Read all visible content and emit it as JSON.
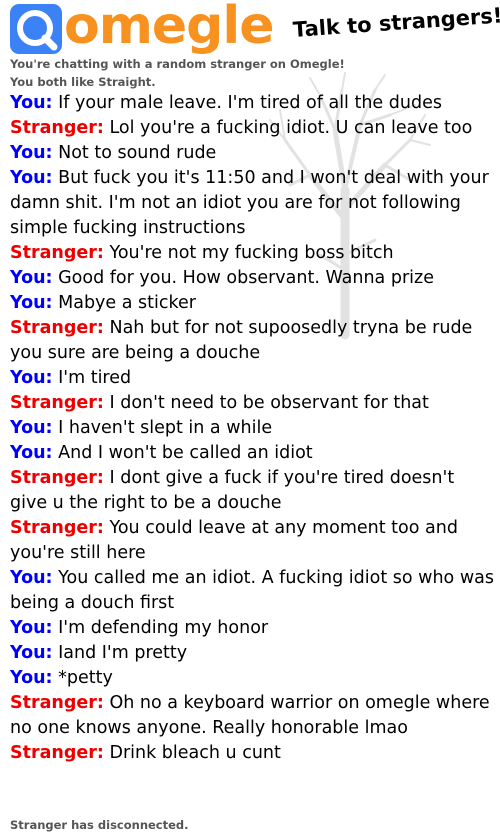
{
  "header": {
    "logo_text": "omegle",
    "tagline": "Talk to strangers!"
  },
  "status": {
    "intro": "You're chatting with a random stranger on Omegle!",
    "likes": "You both like Straight.",
    "end": "Stranger has disconnected."
  },
  "speakers": {
    "you": "You:",
    "stranger": "Stranger:"
  },
  "colors": {
    "you": "#0000ff",
    "stranger": "#ee0000",
    "brand_orange": "#f7911f",
    "brand_blue": "#3b82f6"
  },
  "messages": [
    {
      "speaker": "you",
      "text": "If your male leave. I'm tired of all the dudes"
    },
    {
      "speaker": "stranger",
      "text": "Lol you're a fucking idiot. U can leave too"
    },
    {
      "speaker": "you",
      "text": "Not to sound rude"
    },
    {
      "speaker": "you",
      "text": "But fuck you it's 11:50 and I won't deal with your damn shit. I'm not an idiot you are for not following simple fucking instructions"
    },
    {
      "speaker": "stranger",
      "text": "You're not my fucking boss bitch"
    },
    {
      "speaker": "you",
      "text": "Good for you. How observant. Wanna prize"
    },
    {
      "speaker": "you",
      "text": "Mabye a sticker"
    },
    {
      "speaker": "stranger",
      "text": "Nah but for not supoosedly tryna be rude you sure are being a douche"
    },
    {
      "speaker": "you",
      "text": "I'm tired"
    },
    {
      "speaker": "stranger",
      "text": "I don't need to be observant for that"
    },
    {
      "speaker": "you",
      "text": "I haven't slept in a while"
    },
    {
      "speaker": "you",
      "text": "And I won't be called an idiot"
    },
    {
      "speaker": "stranger",
      "text": "I dont give a fuck if you're tired doesn't give u the right to be a douche"
    },
    {
      "speaker": "stranger",
      "text": "You could leave at any moment too and you're still here"
    },
    {
      "speaker": "you",
      "text": "You called me an idiot. A fucking idiot so who was being a douch first"
    },
    {
      "speaker": "you",
      "text": "I'm defending my honor"
    },
    {
      "speaker": "you",
      "text": "Iand I'm pretty"
    },
    {
      "speaker": "you",
      "text": "*petty"
    },
    {
      "speaker": "stranger",
      "text": "Oh no a keyboard warrior on omegle where no one knows anyone. Really honorable lmao"
    },
    {
      "speaker": "stranger",
      "text": "Drink bleach u cunt"
    }
  ]
}
